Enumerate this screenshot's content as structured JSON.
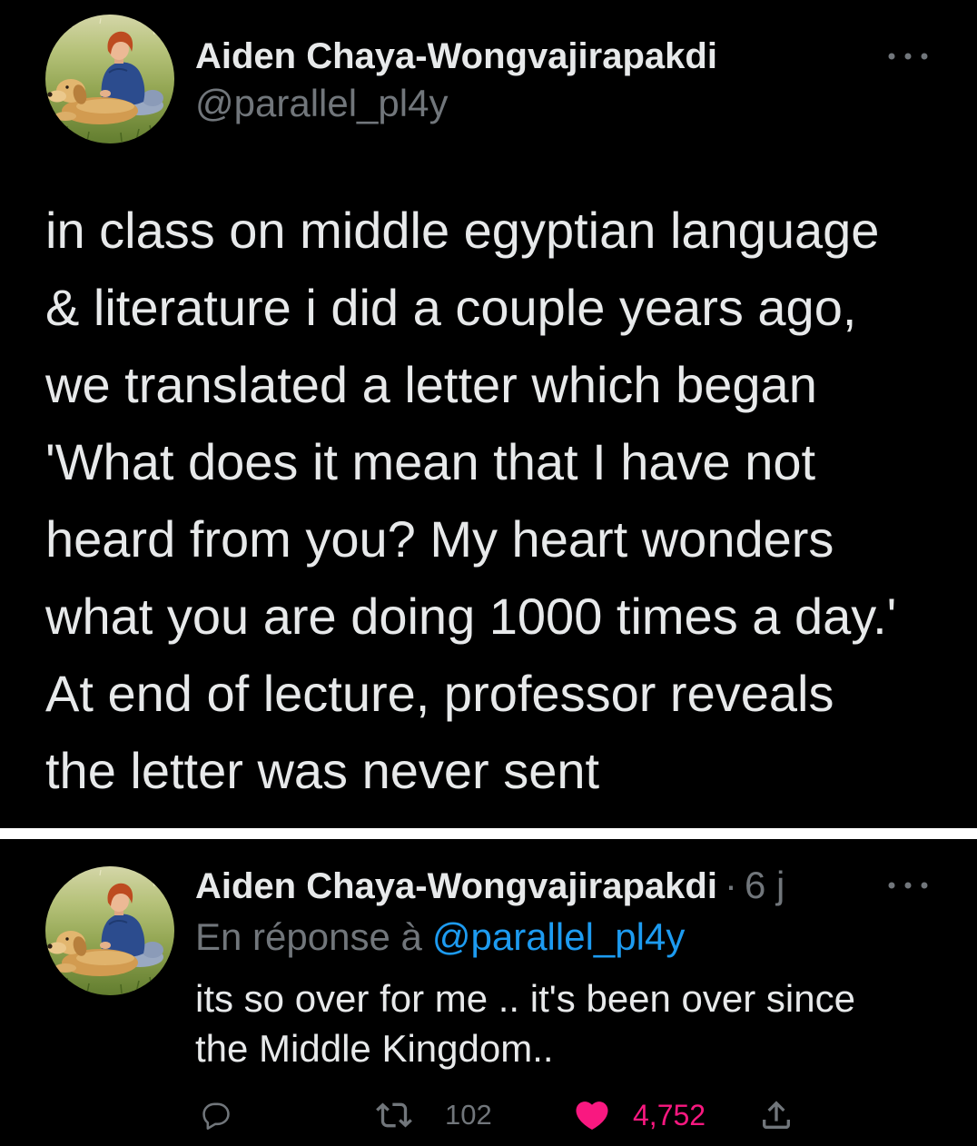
{
  "colors": {
    "background": "#000000",
    "text": "#e7e9ea",
    "secondary_text": "#71767b",
    "link": "#1d9bf0",
    "like": "#f91880",
    "divider": "#ffffff"
  },
  "tweet": {
    "author_name": "Aiden Chaya-Wongvajirapakdi",
    "author_handle": "@parallel_pl4y",
    "more_icon": "more-icon",
    "text_lines": [
      "in class on middle egyptian language",
      "& literature i did a couple years ago,",
      "we translated a letter which began",
      "'What does it mean that I have not",
      "heard from you? My heart wonders",
      "what you are doing 1000 times a day.'",
      "At end of lecture, professor reveals",
      "the letter was never sent"
    ]
  },
  "reply": {
    "author_name": "Aiden Chaya-Wongvajirapakdi",
    "separator": "·",
    "timestamp": "6 j",
    "more_icon": "more-icon",
    "replying_to_label": "En réponse à",
    "replying_to_handle": "@parallel_pl4y",
    "text_lines": [
      "its so over for me .. it's been over since",
      "the Middle Kingdom.."
    ],
    "actions": {
      "reply": {
        "icon": "reply-icon"
      },
      "retweet": {
        "icon": "retweet-icon",
        "count": "102"
      },
      "like": {
        "icon": "heart-icon",
        "count": "4,752",
        "liked": true
      },
      "share": {
        "icon": "share-icon"
      }
    }
  }
}
